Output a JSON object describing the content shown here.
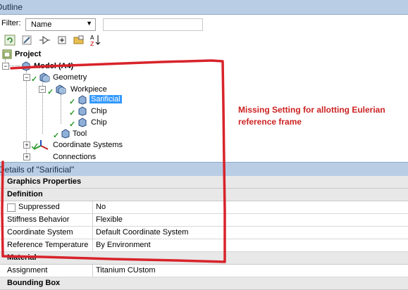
{
  "outline": {
    "title": "Outline"
  },
  "filter": {
    "label": "Filter:",
    "selected": "Name",
    "search_value": ""
  },
  "toolbar": {
    "icons": [
      "refresh-icon",
      "clear-icon",
      "connect-icon",
      "expand-icon",
      "folder-icon",
      "sort-az-icon"
    ]
  },
  "tree": {
    "project": "Project",
    "model": "Model (A4)",
    "geometry": "Geometry",
    "workpiece": "Workpiece",
    "sarificial": "Sarificial",
    "chip1": "Chip",
    "chip2": "Chip",
    "tool": "Tool",
    "coordinate_systems": "Coordinate Systems",
    "connections": "Connections"
  },
  "annotation": {
    "text": "Missing Setting for allotting Eulerian reference frame",
    "color": "#cc2222"
  },
  "details": {
    "title": "Details of \"Sarificial\"",
    "categories": {
      "graphics": "Graphics Properties",
      "definition": "Definition",
      "material": "Material",
      "bounding": "Bounding Box"
    },
    "rows": {
      "suppressed": {
        "name": "Suppressed",
        "value": "No"
      },
      "stiffness": {
        "name": "Stiffness Behavior",
        "value": "Flexible"
      },
      "coordsys": {
        "name": "Coordinate System",
        "value": "Default Coordinate System"
      },
      "reftemp": {
        "name": "Reference Temperature",
        "value": "By Environment"
      },
      "assignment": {
        "name": "Assignment",
        "value": "Titanium CUstom"
      }
    }
  },
  "colors": {
    "title_bar": "#b9cde5",
    "selection": "#3399ff",
    "red_markup": "#d8232a"
  }
}
